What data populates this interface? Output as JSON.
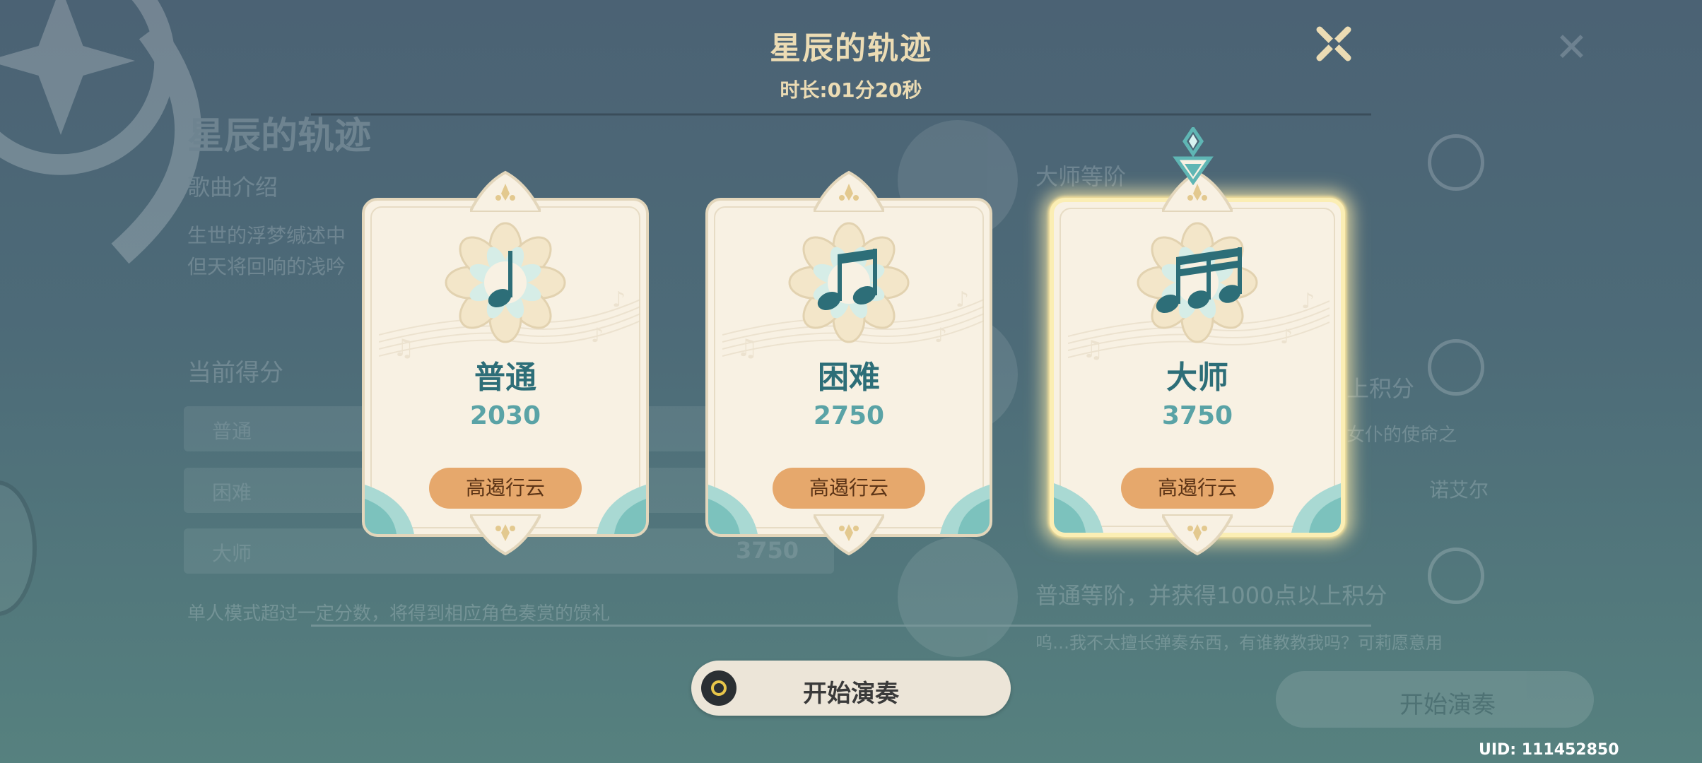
{
  "dialog": {
    "title": "星辰的轨迹",
    "duration": "时长:01分20秒"
  },
  "difficulties": [
    {
      "name": "普通",
      "score": "2030",
      "rank": "高遏行云",
      "notes": 1,
      "selected": false
    },
    {
      "name": "困难",
      "score": "2750",
      "rank": "高遏行云",
      "notes": 2,
      "selected": false
    },
    {
      "name": "大师",
      "score": "3750",
      "rank": "高遏行云",
      "notes": 3,
      "selected": true
    }
  ],
  "start_button": {
    "label": "开始演奏"
  },
  "uid": "UID: 111452850",
  "background": {
    "title": "星辰的轨迹",
    "subtitle": "歌曲介绍",
    "desc_line1": "生世的浮梦缄述中",
    "desc_line2": "但天将回响的浅吟",
    "current_score_label": "当前得分",
    "rows": [
      {
        "label": "普通",
        "value": ""
      },
      {
        "label": "困难",
        "value": ""
      },
      {
        "label": "大师",
        "value": "3750"
      }
    ],
    "note": "单人模式超过一定分数，将得到相应角色奏赏的馈礼",
    "right_lines": [
      "大师等阶",
      "上积分",
      "普通等阶，并获得1000点以上积分",
      "女仆的使命之",
      "诺艾尔",
      "呜…我不太擅长弹奏东西，有谁教教我吗？可莉愿意用"
    ],
    "start_label": "开始演奏"
  },
  "colors": {
    "title_gold": "#ecdcb4",
    "card_bg": "#f8f1e3",
    "name_teal": "#2d6e78",
    "score_teal": "#5aa3a6",
    "badge_orange": "#e6a86c",
    "selected_glow": "#fbeeb4"
  },
  "icons": {
    "close": "close-x-icon",
    "note": "music-note-icon",
    "marker": "diamond-marker-icon",
    "start": "gamepad-button-icon"
  }
}
